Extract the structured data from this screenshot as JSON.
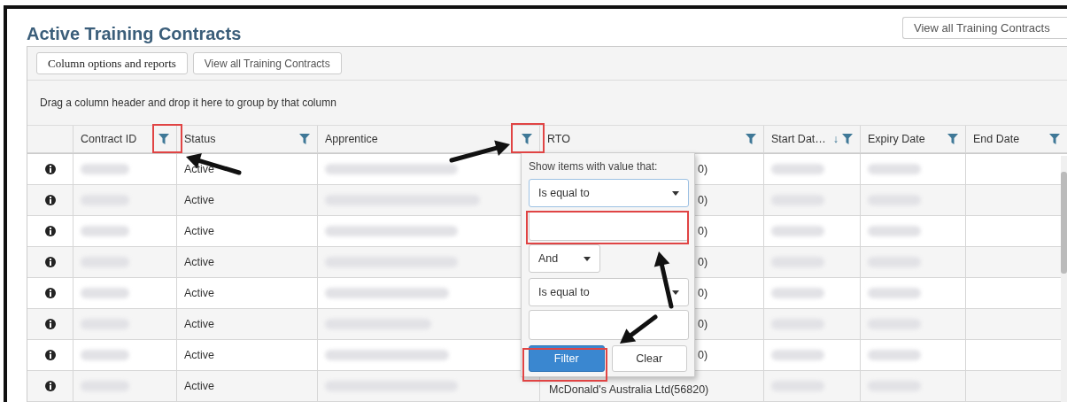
{
  "title": "Active Training Contracts",
  "top_button": "View all Training Contracts",
  "toolbar": {
    "buttons": [
      "Column options and reports",
      "View all Training Contracts"
    ]
  },
  "group_hint": "Drag a column header and drop it here to group by that column",
  "table": {
    "columns": [
      {
        "label": "Contract ID",
        "filter": true
      },
      {
        "label": "Status",
        "filter": true
      },
      {
        "label": "Apprentice",
        "filter": true
      },
      {
        "label": "RTO",
        "filter": true
      },
      {
        "label": "Start Dat…",
        "filter": true,
        "sort": "↓"
      },
      {
        "label": "Expiry Date",
        "filter": true
      },
      {
        "label": "End Date",
        "filter": true
      }
    ],
    "rows": [
      {
        "status": "Active",
        "rto": "0)",
        "covered": true
      },
      {
        "status": "Active",
        "rto": "0)",
        "covered": true
      },
      {
        "status": "Active",
        "rto": "0)",
        "covered": true
      },
      {
        "status": "Active",
        "rto": "0)",
        "covered": true
      },
      {
        "status": "Active",
        "rto": "0)",
        "covered": true
      },
      {
        "status": "Active",
        "rto": "0)",
        "covered": true
      },
      {
        "status": "Active",
        "rto": "0)",
        "covered": true
      },
      {
        "status": "Active",
        "rto": "McDonald's Australia Ltd(56820)",
        "covered": false
      }
    ]
  },
  "filter_popup": {
    "label": "Show items with value that:",
    "operator_1": "Is equal to",
    "logic": "And",
    "operator_2": "Is equal to",
    "buttons": [
      {
        "label": "Filter",
        "primary": true
      },
      {
        "label": "Clear",
        "primary": false
      }
    ]
  }
}
